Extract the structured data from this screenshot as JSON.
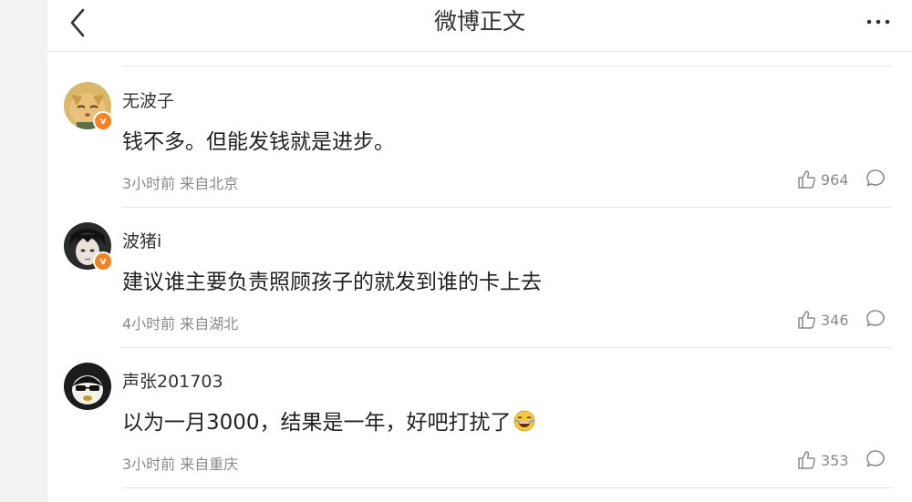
{
  "nav": {
    "title": "微博正文"
  },
  "comments": [
    {
      "username": "无波子",
      "content": "钱不多。但能发钱就是进步。",
      "time": "3小时前",
      "source": "来自北京",
      "likes": "964",
      "verified_badge": "v"
    },
    {
      "username": "波猪i",
      "content": "建议谁主要负责照顾孩子的就发到谁的卡上去",
      "time": "4小时前",
      "source": "来自湖北",
      "likes": "346",
      "verified_badge": "v"
    },
    {
      "username": "声张201703",
      "content": "以为一月3000，结果是一年，好吧打扰了",
      "time": "3小时前",
      "source": "来自重庆",
      "likes": "353"
    }
  ],
  "colors": {
    "badge": "#f58322",
    "meta": "#8a8a8a",
    "text": "#222222"
  },
  "icons": {
    "back": "chevron-left-icon",
    "more": "more-dots-icon",
    "like": "thumbs-up-icon",
    "comment": "comment-bubble-icon",
    "emoji": "laughing-crying-emoji-icon"
  }
}
